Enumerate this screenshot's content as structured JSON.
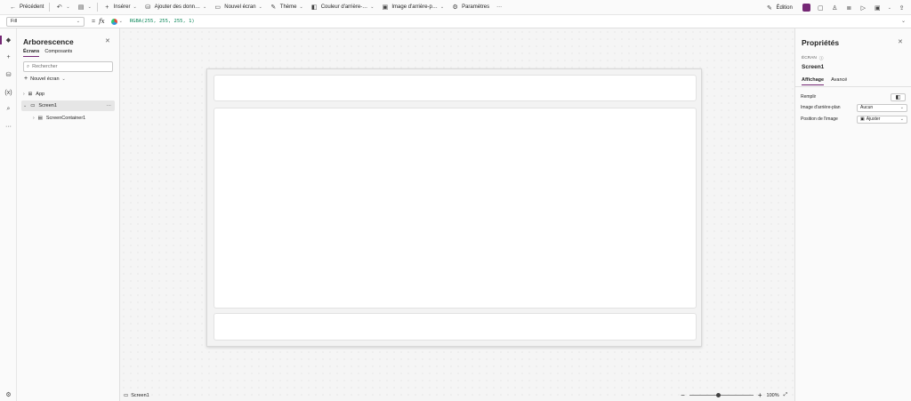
{
  "toolbar": {
    "back": "Précédent",
    "insert": "Insérer",
    "add_data": "Ajouter des donn…",
    "new_screen": "Nouvel écran",
    "theme": "Thème",
    "bg_color": "Couleur d'arrière-…",
    "bg_image": "Image d'arrière-p…",
    "settings": "Paramètres",
    "more": "···",
    "edit": "Édition"
  },
  "formula": {
    "property": "Fill",
    "equals": "=",
    "fx": "fx",
    "value": "RGBA(255, 255, 255, 1)"
  },
  "tree": {
    "title": "Arborescence",
    "tabs": [
      "Écrans",
      "Composants"
    ],
    "search_placeholder": "Rechercher",
    "new_screen": "Nouvel écran",
    "items": [
      {
        "label": "App"
      },
      {
        "label": "Screen1"
      },
      {
        "label": "ScreenContainer1"
      }
    ],
    "more": "···"
  },
  "canvas": {
    "status_screen": "Screen1",
    "zoom": "100%",
    "zoom_fraction": 0.45
  },
  "properties": {
    "title": "Propriétés",
    "type_label": "ÉCRAN",
    "name": "Screen1",
    "tabs": [
      "Affichage",
      "Avancé"
    ],
    "fill_label": "Remplir",
    "bg_image_label": "Image d'arrière-plan",
    "bg_image_value": "Aucun",
    "image_position_label": "Position de l'image",
    "image_position_value": "Ajuster"
  },
  "colors": {
    "accent": "#742774",
    "formula_text": "#098658"
  }
}
